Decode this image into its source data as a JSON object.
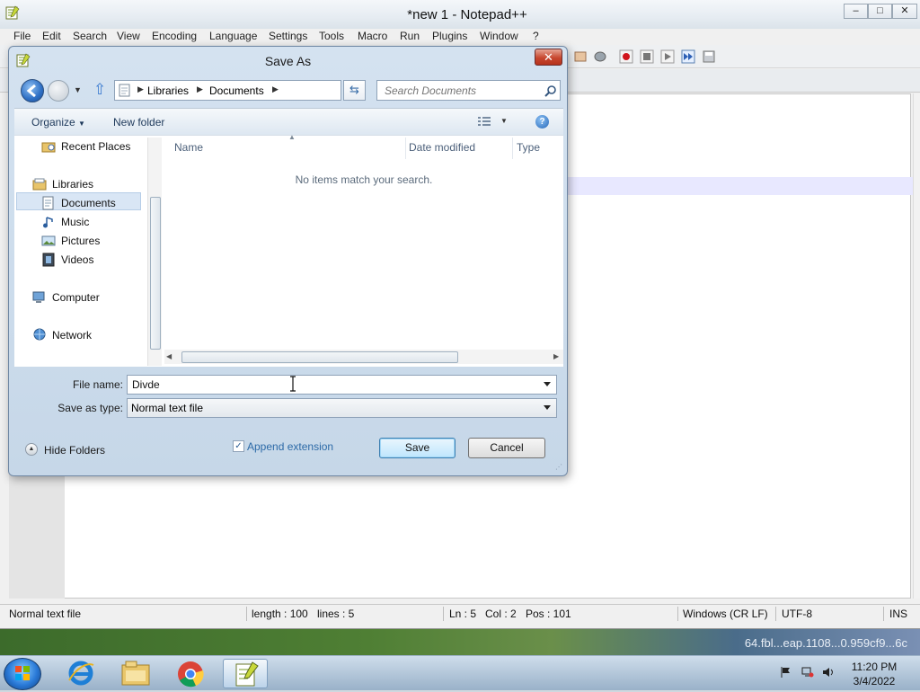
{
  "notepad": {
    "title": "*new 1 - Notepad++",
    "window_buttons": [
      "–",
      "□",
      "✕"
    ],
    "menu": [
      "File",
      "Edit",
      "Search",
      "View",
      "Encoding",
      "Language",
      "Settings",
      "Tools",
      "Macro",
      "Run",
      "Plugins",
      "Window",
      "?"
    ],
    "status": {
      "type": "Normal text file",
      "length": "length : 100",
      "lines": "lines : 5",
      "ln": "Ln : 5",
      "col": "Col : 2",
      "pos": "Pos : 101",
      "eol": "Windows (CR LF)",
      "encoding": "UTF-8",
      "mode": "INS"
    }
  },
  "dialog": {
    "title": "Save As",
    "close": "✕",
    "breadcrumb": [
      "Libraries",
      "Documents"
    ],
    "search_placeholder": "Search Documents",
    "organize": "Organize",
    "new_folder": "New folder",
    "help": "?",
    "nav": [
      "Recent Places",
      "Libraries",
      "Documents",
      "Music",
      "Pictures",
      "Videos",
      "Computer",
      "Network"
    ],
    "columns": [
      "Name",
      "Date modified",
      "Type"
    ],
    "empty_message": "No items match your search.",
    "file_name_label": "File name:",
    "file_name_value": "Divde",
    "save_type_label": "Save as type:",
    "save_type_value": "Normal text file",
    "append_extension": "Append extension",
    "append_checked": true,
    "hide_folders": "Hide Folders",
    "save": "Save",
    "cancel": "Cancel"
  },
  "taskbar": {
    "desktop_filename": "64.fbl...eap.1108...0.959cf9...6c",
    "time": "11:20 PM",
    "date": "3/4/2022"
  }
}
